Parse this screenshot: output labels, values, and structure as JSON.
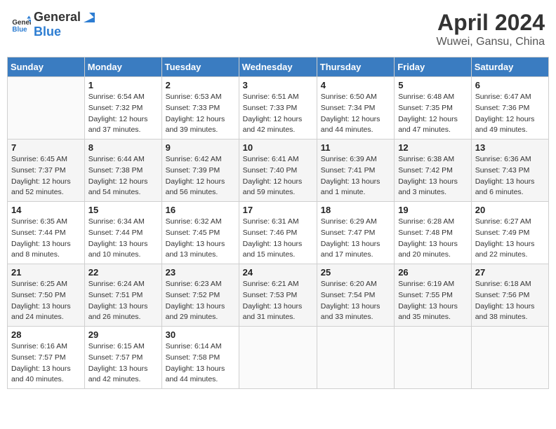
{
  "header": {
    "logo_general": "General",
    "logo_blue": "Blue",
    "title": "April 2024",
    "subtitle": "Wuwei, Gansu, China"
  },
  "days_of_week": [
    "Sunday",
    "Monday",
    "Tuesday",
    "Wednesday",
    "Thursday",
    "Friday",
    "Saturday"
  ],
  "weeks": [
    [
      {
        "day": "",
        "sunrise": "",
        "sunset": "",
        "daylight": ""
      },
      {
        "day": "1",
        "sunrise": "Sunrise: 6:54 AM",
        "sunset": "Sunset: 7:32 PM",
        "daylight": "Daylight: 12 hours and 37 minutes."
      },
      {
        "day": "2",
        "sunrise": "Sunrise: 6:53 AM",
        "sunset": "Sunset: 7:33 PM",
        "daylight": "Daylight: 12 hours and 39 minutes."
      },
      {
        "day": "3",
        "sunrise": "Sunrise: 6:51 AM",
        "sunset": "Sunset: 7:33 PM",
        "daylight": "Daylight: 12 hours and 42 minutes."
      },
      {
        "day": "4",
        "sunrise": "Sunrise: 6:50 AM",
        "sunset": "Sunset: 7:34 PM",
        "daylight": "Daylight: 12 hours and 44 minutes."
      },
      {
        "day": "5",
        "sunrise": "Sunrise: 6:48 AM",
        "sunset": "Sunset: 7:35 PM",
        "daylight": "Daylight: 12 hours and 47 minutes."
      },
      {
        "day": "6",
        "sunrise": "Sunrise: 6:47 AM",
        "sunset": "Sunset: 7:36 PM",
        "daylight": "Daylight: 12 hours and 49 minutes."
      }
    ],
    [
      {
        "day": "7",
        "sunrise": "Sunrise: 6:45 AM",
        "sunset": "Sunset: 7:37 PM",
        "daylight": "Daylight: 12 hours and 52 minutes."
      },
      {
        "day": "8",
        "sunrise": "Sunrise: 6:44 AM",
        "sunset": "Sunset: 7:38 PM",
        "daylight": "Daylight: 12 hours and 54 minutes."
      },
      {
        "day": "9",
        "sunrise": "Sunrise: 6:42 AM",
        "sunset": "Sunset: 7:39 PM",
        "daylight": "Daylight: 12 hours and 56 minutes."
      },
      {
        "day": "10",
        "sunrise": "Sunrise: 6:41 AM",
        "sunset": "Sunset: 7:40 PM",
        "daylight": "Daylight: 12 hours and 59 minutes."
      },
      {
        "day": "11",
        "sunrise": "Sunrise: 6:39 AM",
        "sunset": "Sunset: 7:41 PM",
        "daylight": "Daylight: 13 hours and 1 minute."
      },
      {
        "day": "12",
        "sunrise": "Sunrise: 6:38 AM",
        "sunset": "Sunset: 7:42 PM",
        "daylight": "Daylight: 13 hours and 3 minutes."
      },
      {
        "day": "13",
        "sunrise": "Sunrise: 6:36 AM",
        "sunset": "Sunset: 7:43 PM",
        "daylight": "Daylight: 13 hours and 6 minutes."
      }
    ],
    [
      {
        "day": "14",
        "sunrise": "Sunrise: 6:35 AM",
        "sunset": "Sunset: 7:44 PM",
        "daylight": "Daylight: 13 hours and 8 minutes."
      },
      {
        "day": "15",
        "sunrise": "Sunrise: 6:34 AM",
        "sunset": "Sunset: 7:44 PM",
        "daylight": "Daylight: 13 hours and 10 minutes."
      },
      {
        "day": "16",
        "sunrise": "Sunrise: 6:32 AM",
        "sunset": "Sunset: 7:45 PM",
        "daylight": "Daylight: 13 hours and 13 minutes."
      },
      {
        "day": "17",
        "sunrise": "Sunrise: 6:31 AM",
        "sunset": "Sunset: 7:46 PM",
        "daylight": "Daylight: 13 hours and 15 minutes."
      },
      {
        "day": "18",
        "sunrise": "Sunrise: 6:29 AM",
        "sunset": "Sunset: 7:47 PM",
        "daylight": "Daylight: 13 hours and 17 minutes."
      },
      {
        "day": "19",
        "sunrise": "Sunrise: 6:28 AM",
        "sunset": "Sunset: 7:48 PM",
        "daylight": "Daylight: 13 hours and 20 minutes."
      },
      {
        "day": "20",
        "sunrise": "Sunrise: 6:27 AM",
        "sunset": "Sunset: 7:49 PM",
        "daylight": "Daylight: 13 hours and 22 minutes."
      }
    ],
    [
      {
        "day": "21",
        "sunrise": "Sunrise: 6:25 AM",
        "sunset": "Sunset: 7:50 PM",
        "daylight": "Daylight: 13 hours and 24 minutes."
      },
      {
        "day": "22",
        "sunrise": "Sunrise: 6:24 AM",
        "sunset": "Sunset: 7:51 PM",
        "daylight": "Daylight: 13 hours and 26 minutes."
      },
      {
        "day": "23",
        "sunrise": "Sunrise: 6:23 AM",
        "sunset": "Sunset: 7:52 PM",
        "daylight": "Daylight: 13 hours and 29 minutes."
      },
      {
        "day": "24",
        "sunrise": "Sunrise: 6:21 AM",
        "sunset": "Sunset: 7:53 PM",
        "daylight": "Daylight: 13 hours and 31 minutes."
      },
      {
        "day": "25",
        "sunrise": "Sunrise: 6:20 AM",
        "sunset": "Sunset: 7:54 PM",
        "daylight": "Daylight: 13 hours and 33 minutes."
      },
      {
        "day": "26",
        "sunrise": "Sunrise: 6:19 AM",
        "sunset": "Sunset: 7:55 PM",
        "daylight": "Daylight: 13 hours and 35 minutes."
      },
      {
        "day": "27",
        "sunrise": "Sunrise: 6:18 AM",
        "sunset": "Sunset: 7:56 PM",
        "daylight": "Daylight: 13 hours and 38 minutes."
      }
    ],
    [
      {
        "day": "28",
        "sunrise": "Sunrise: 6:16 AM",
        "sunset": "Sunset: 7:57 PM",
        "daylight": "Daylight: 13 hours and 40 minutes."
      },
      {
        "day": "29",
        "sunrise": "Sunrise: 6:15 AM",
        "sunset": "Sunset: 7:57 PM",
        "daylight": "Daylight: 13 hours and 42 minutes."
      },
      {
        "day": "30",
        "sunrise": "Sunrise: 6:14 AM",
        "sunset": "Sunset: 7:58 PM",
        "daylight": "Daylight: 13 hours and 44 minutes."
      },
      {
        "day": "",
        "sunrise": "",
        "sunset": "",
        "daylight": ""
      },
      {
        "day": "",
        "sunrise": "",
        "sunset": "",
        "daylight": ""
      },
      {
        "day": "",
        "sunrise": "",
        "sunset": "",
        "daylight": ""
      },
      {
        "day": "",
        "sunrise": "",
        "sunset": "",
        "daylight": ""
      }
    ]
  ]
}
